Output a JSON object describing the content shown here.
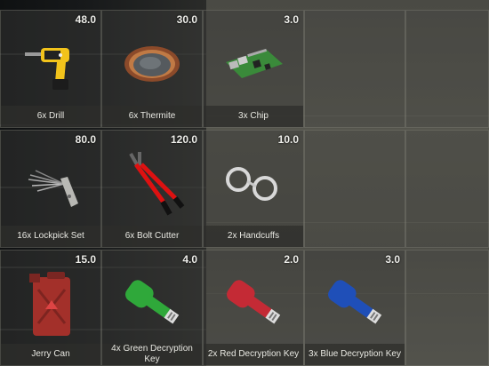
{
  "inventory": {
    "slots": [
      {
        "label": "6x Drill",
        "weight": "48.0",
        "icon": "drill-icon"
      },
      {
        "label": "6x Thermite",
        "weight": "30.0",
        "icon": "thermite-icon"
      },
      {
        "label": "3x Chip",
        "weight": "3.0",
        "icon": "chip-icon"
      },
      {
        "label": "16x Lockpick Set",
        "weight": "80.0",
        "icon": "lockpick-icon"
      },
      {
        "label": "6x Bolt Cutter",
        "weight": "120.0",
        "icon": "bolt-cutter-icon"
      },
      {
        "label": "2x Handcuffs",
        "weight": "10.0",
        "icon": "handcuffs-icon"
      },
      {
        "label": "Jerry Can",
        "weight": "15.0",
        "icon": "jerry-can-icon"
      },
      {
        "label": "4x Green Decryption Key",
        "weight": "4.0",
        "icon": "green-key-icon",
        "color": "#2fa83a"
      },
      {
        "label": "2x Red Decryption Key",
        "weight": "2.0",
        "icon": "red-key-icon",
        "color": "#c42a35"
      },
      {
        "label": "3x Blue Decryption Key",
        "weight": "3.0",
        "icon": "blue-key-icon",
        "color": "#1f4fb8"
      }
    ]
  }
}
